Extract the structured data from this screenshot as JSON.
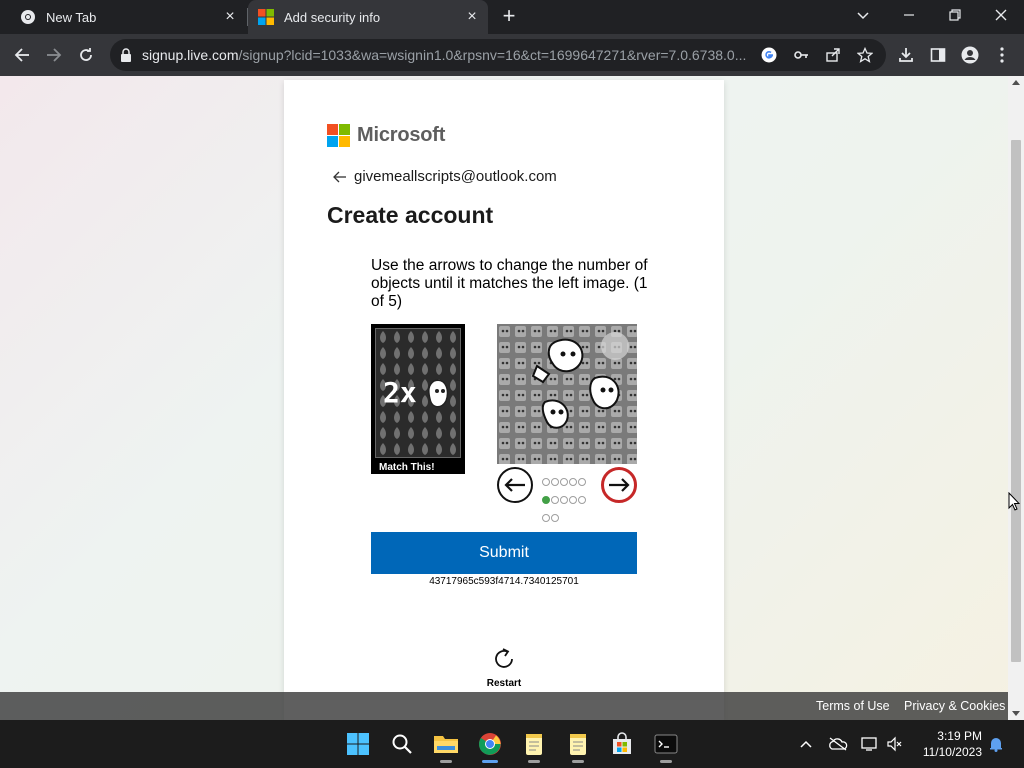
{
  "browser": {
    "tabs": [
      {
        "title": "New Tab"
      },
      {
        "title": "Add security info"
      }
    ],
    "url_host": "signup.live.com",
    "url_path": "/signup?lcid=1033&wa=wsignin1.0&rpsnv=16&ct=1699647271&rver=7.0.6738.0..."
  },
  "page": {
    "brand": "Microsoft",
    "account_email": "givemeallscripts@outlook.com",
    "title": "Create account",
    "instructions": "Use the arrows to change the number of objects until it matches the left image. (1 of 5)",
    "match_count": "2x",
    "match_label": "Match This!",
    "submit_label": "Submit",
    "session_id": "43717965c593f4714.7340125701",
    "restart_label": "Restart",
    "selector": {
      "total": 12,
      "selected_index": 5
    },
    "colors": {
      "primary": "#0067b8",
      "selected_dot": "#43a047",
      "arrow_highlight": "#c62828"
    }
  },
  "footer": {
    "terms": "Terms of Use",
    "privacy": "Privacy & Cookies"
  },
  "taskbar": {
    "time": "3:19 PM",
    "date": "11/10/2023",
    "apps": [
      "start-icon",
      "search-icon",
      "file-explorer-icon",
      "chrome-icon",
      "notepad-icon",
      "notepad-icon",
      "store-icon",
      "terminal-icon"
    ]
  }
}
